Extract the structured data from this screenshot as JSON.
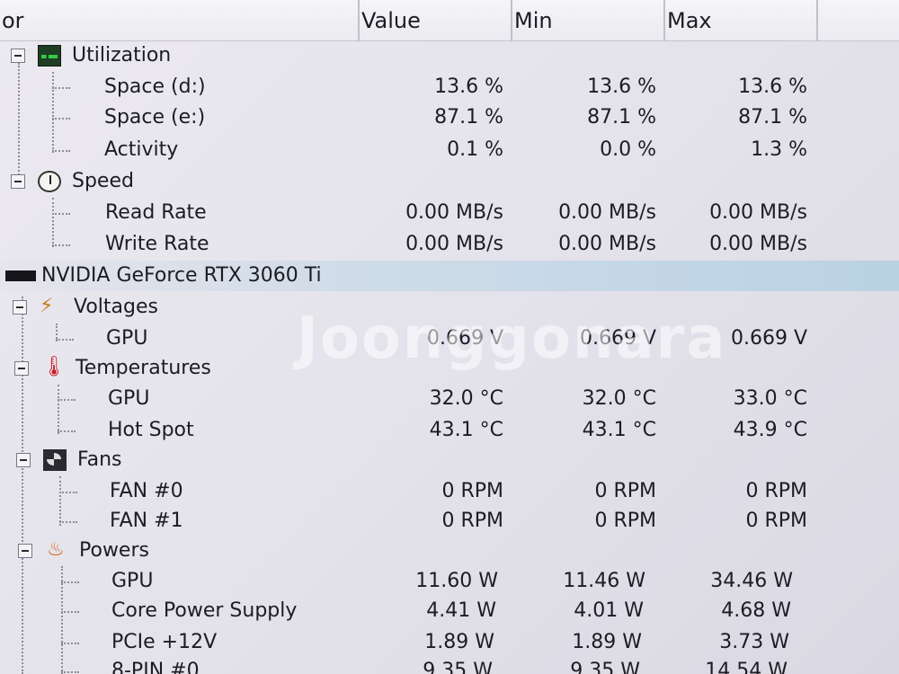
{
  "columns": {
    "sensor": "or",
    "value": "Value",
    "min": "Min",
    "max": "Max"
  },
  "groups": {
    "utilization": "Utilization",
    "speed": "Speed",
    "device": "NVIDIA GeForce RTX 3060 Ti",
    "voltages": "Voltages",
    "temperatures": "Temperatures",
    "fans": "Fans",
    "powers": "Powers"
  },
  "rows": {
    "space_d": {
      "label": "Space (d:)",
      "value": "13.6 %",
      "min": "13.6 %",
      "max": "13.6 %"
    },
    "space_e": {
      "label": "Space (e:)",
      "value": "87.1 %",
      "min": "87.1 %",
      "max": "87.1 %"
    },
    "activity": {
      "label": "Activity",
      "value": "0.1 %",
      "min": "0.0 %",
      "max": "1.3 %"
    },
    "read_rate": {
      "label": "Read Rate",
      "value": "0.00 MB/s",
      "min": "0.00 MB/s",
      "max": "0.00 MB/s"
    },
    "write_rate": {
      "label": "Write Rate",
      "value": "0.00 MB/s",
      "min": "0.00 MB/s",
      "max": "0.00 MB/s"
    },
    "volt_gpu": {
      "label": "GPU",
      "value": "0.669 V",
      "min": "0.669 V",
      "max": "0.669 V"
    },
    "temp_gpu": {
      "label": "GPU",
      "value": "32.0 °C",
      "min": "32.0 °C",
      "max": "33.0 °C"
    },
    "hot_spot": {
      "label": "Hot Spot",
      "value": "43.1 °C",
      "min": "43.1 °C",
      "max": "43.9 °C"
    },
    "fan0": {
      "label": "FAN #0",
      "value": "0 RPM",
      "min": "0 RPM",
      "max": "0 RPM"
    },
    "fan1": {
      "label": "FAN #1",
      "value": "0 RPM",
      "min": "0 RPM",
      "max": "0 RPM"
    },
    "pow_gpu": {
      "label": "GPU",
      "value": "11.60 W",
      "min": "11.46 W",
      "max": "34.46 W"
    },
    "core_power": {
      "label": "Core Power Supply",
      "value": "4.41 W",
      "min": "4.01 W",
      "max": "4.68 W"
    },
    "pcie": {
      "label": "PCIe +12V",
      "value": "1.89 W",
      "min": "1.89 W",
      "max": "3.73 W"
    },
    "pin8": {
      "label": "8-PIN #0",
      "value": "9.35 W",
      "min": "9.35 W",
      "max": "14.54 W"
    }
  },
  "watermark": "Joonggonara"
}
